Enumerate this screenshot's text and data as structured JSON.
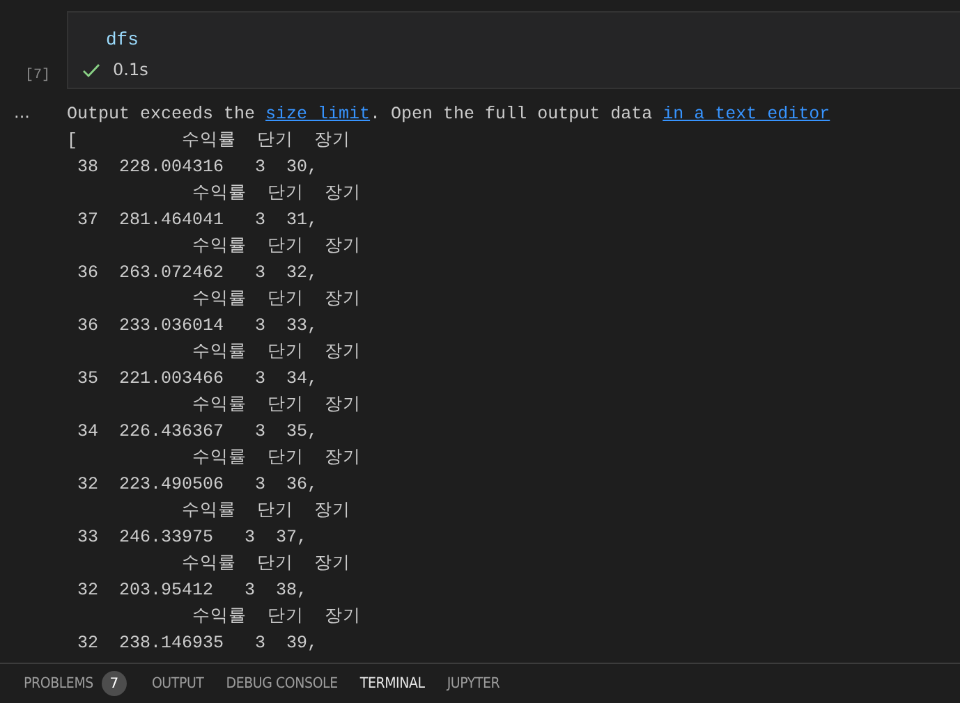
{
  "cell": {
    "execution_count": "[7]",
    "code": "dfs",
    "succeeded": true,
    "duration": "0.1s"
  },
  "output": {
    "more_button": "···",
    "notice_before": "Output exceeds the ",
    "link_1": "size limit",
    "notice_middle": ". Open the full output data ",
    "link_2": "in a text editor",
    "lines": [
      "[          수익률  단기  장기",
      " 38  228.004316   3  30,",
      "            수익률  단기  장기",
      " 37  281.464041   3  31,",
      "            수익률  단기  장기",
      " 36  263.072462   3  32,",
      "            수익률  단기  장기",
      " 36  233.036014   3  33,",
      "            수익률  단기  장기",
      " 35  221.003466   3  34,",
      "            수익률  단기  장기",
      " 34  226.436367   3  35,",
      "            수익률  단기  장기",
      " 32  223.490506   3  36,",
      "           수익률  단기  장기",
      " 33  246.33975   3  37,",
      "           수익률  단기  장기",
      " 32  203.95412   3  38,",
      "            수익률  단기  장기",
      " 32  238.146935   3  39,"
    ]
  },
  "panel_tabs": [
    {
      "label": "PROBLEMS",
      "badge": "7",
      "selected": false
    },
    {
      "label": "OUTPUT",
      "selected": false
    },
    {
      "label": "DEBUG CONSOLE",
      "selected": false
    },
    {
      "label": "TERMINAL",
      "selected": true
    },
    {
      "label": "JUPYTER",
      "selected": false
    }
  ]
}
